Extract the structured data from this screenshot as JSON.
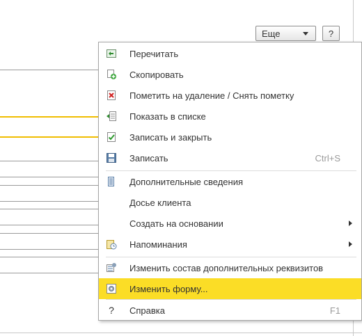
{
  "toolbar": {
    "more_label": "Еще",
    "help_label": "?"
  },
  "menu": {
    "items": [
      {
        "label": "Перечитать",
        "icon": "refresh-icon"
      },
      {
        "label": "Скопировать",
        "icon": "copy-icon"
      },
      {
        "label": "Пометить на удаление / Снять пометку",
        "icon": "delete-mark-icon"
      },
      {
        "label": "Показать в списке",
        "icon": "show-in-list-icon"
      },
      {
        "label": "Записать и закрыть",
        "icon": "save-close-icon"
      },
      {
        "label": "Записать",
        "icon": "save-icon",
        "shortcut": "Ctrl+S"
      },
      {
        "label": "Дополнительные сведения",
        "icon": "additional-info-icon"
      },
      {
        "label": "Досье клиента"
      },
      {
        "label": "Создать на основании",
        "submenu": true
      },
      {
        "label": "Напоминания",
        "icon": "reminder-icon",
        "submenu": true
      },
      {
        "label": "Изменить состав дополнительных реквизитов",
        "icon": "edit-attributes-icon"
      },
      {
        "label": "Изменить форму...",
        "icon": "form-settings-icon",
        "highlighted": true
      },
      {
        "label": "Справка",
        "icon": "help-icon",
        "shortcut": "F1"
      }
    ]
  },
  "colors": {
    "highlight": "#fbdd26",
    "accent_line": "#f0bd00"
  }
}
